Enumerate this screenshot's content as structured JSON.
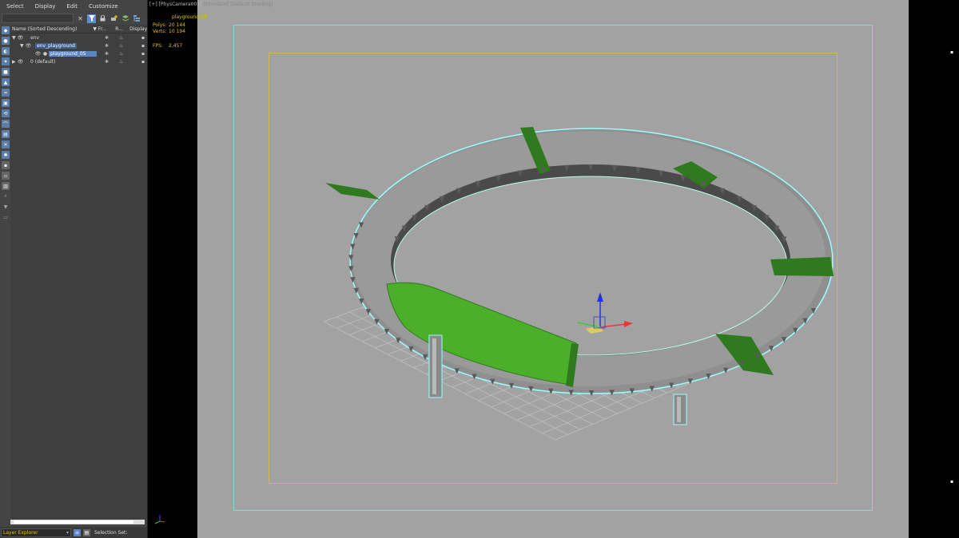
{
  "menubar": {
    "items": [
      "Select",
      "Display",
      "Edit",
      "Customize"
    ]
  },
  "search": {
    "placeholder": "",
    "clear_glyph": "✕"
  },
  "tree": {
    "headers": {
      "name": "Name (Sorted Descending)",
      "frozen": "▼ Fr...",
      "render": "R...",
      "display": "Display"
    },
    "rows": [
      {
        "label": "env",
        "level": 0,
        "state": "expanded"
      },
      {
        "label": "env_playground",
        "level": 1,
        "state": "expanded"
      },
      {
        "label": "playground_05",
        "level": 2,
        "state": "selected"
      },
      {
        "label": "0 (default)",
        "level": 0,
        "state": "collapsed"
      }
    ]
  },
  "statusbar": {
    "layer_dropdown": "Layer Explorer",
    "selection_set": "Selection Set:"
  },
  "viewport": {
    "label_plus": "[+]",
    "camera": "[PhysCamera001]",
    "mode": "[Standard]",
    "shading": "[Default Shading]",
    "object_name": "playground_05",
    "stats": {
      "polys_label": "Polys:",
      "polys": "20 144",
      "verts_label": "Verts:",
      "verts": "10 194",
      "fps_label": "FPS:",
      "fps": "2,457"
    },
    "gizmo_label": "z"
  },
  "colors": {
    "accent": "#5b84c2",
    "status_yellow": "#e2c000",
    "selection_green": "#4caf2a",
    "band_green": "#2f7a1e",
    "ring_grey": "#8f8f8f",
    "viewport_bg": "#a2a2a2",
    "safe_frame_cyan": "#8ed5d5",
    "safe_frame_orange": "#d7b24f"
  },
  "icons": [
    "clear-search-icon",
    "filter-icon",
    "lock-icon",
    "add-layer-icon",
    "layers-icon",
    "hierarchy-icon",
    "eye-icon",
    "visibility-icon",
    "snowflake-icon",
    "render-teapot-icon",
    "move-gizmo-icon",
    "world-axis-icon"
  ]
}
